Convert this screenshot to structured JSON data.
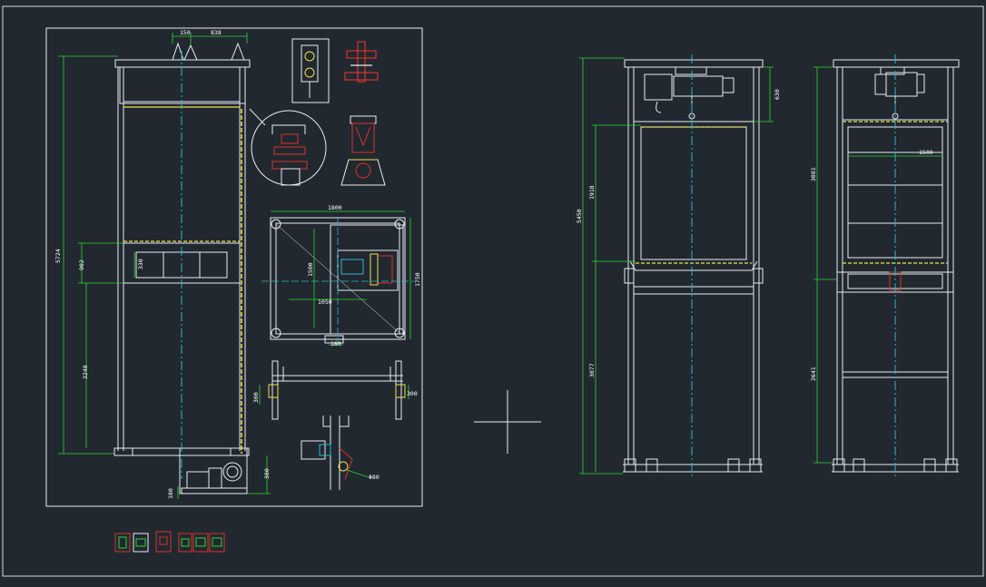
{
  "drawing": {
    "background": "#212830",
    "colors": {
      "line": "#e8ecef",
      "dim": "#2dd62d",
      "center": "#2fb6c9",
      "yellow": "#f0e14a",
      "red": "#d8342c",
      "frame": "#d9dde0"
    },
    "sheet1": {
      "dims": {
        "d_top_a": "150",
        "d_top_b": "838",
        "d_overall_h": "5724",
        "d_mid_a": "902",
        "d_mid_b": "330",
        "d_lower_h": "3248",
        "d_base_a": "380",
        "d_base_b": "180",
        "d_plan_w": "1800",
        "d_plan_in": "1500",
        "d_plan_inner": "1050",
        "d_plan_h": "1750",
        "d_plan_c": "180",
        "d_sec_h": "300",
        "d_sec_b": "300",
        "d_phi": "Φ80"
      }
    },
    "front_view": {
      "dims": {
        "d_total": "5450",
        "d_top": "630",
        "d_upper": "1918",
        "d_lower": "3077"
      }
    },
    "side_view": {
      "dims": {
        "d_upper": "3081",
        "d_width": "1500",
        "d_lower": "2641"
      }
    },
    "thumbnails": [
      {
        "id": "t1"
      },
      {
        "id": "t2"
      },
      {
        "id": "t3"
      },
      {
        "id": "t4"
      },
      {
        "id": "t5"
      },
      {
        "id": "t6"
      }
    ]
  }
}
